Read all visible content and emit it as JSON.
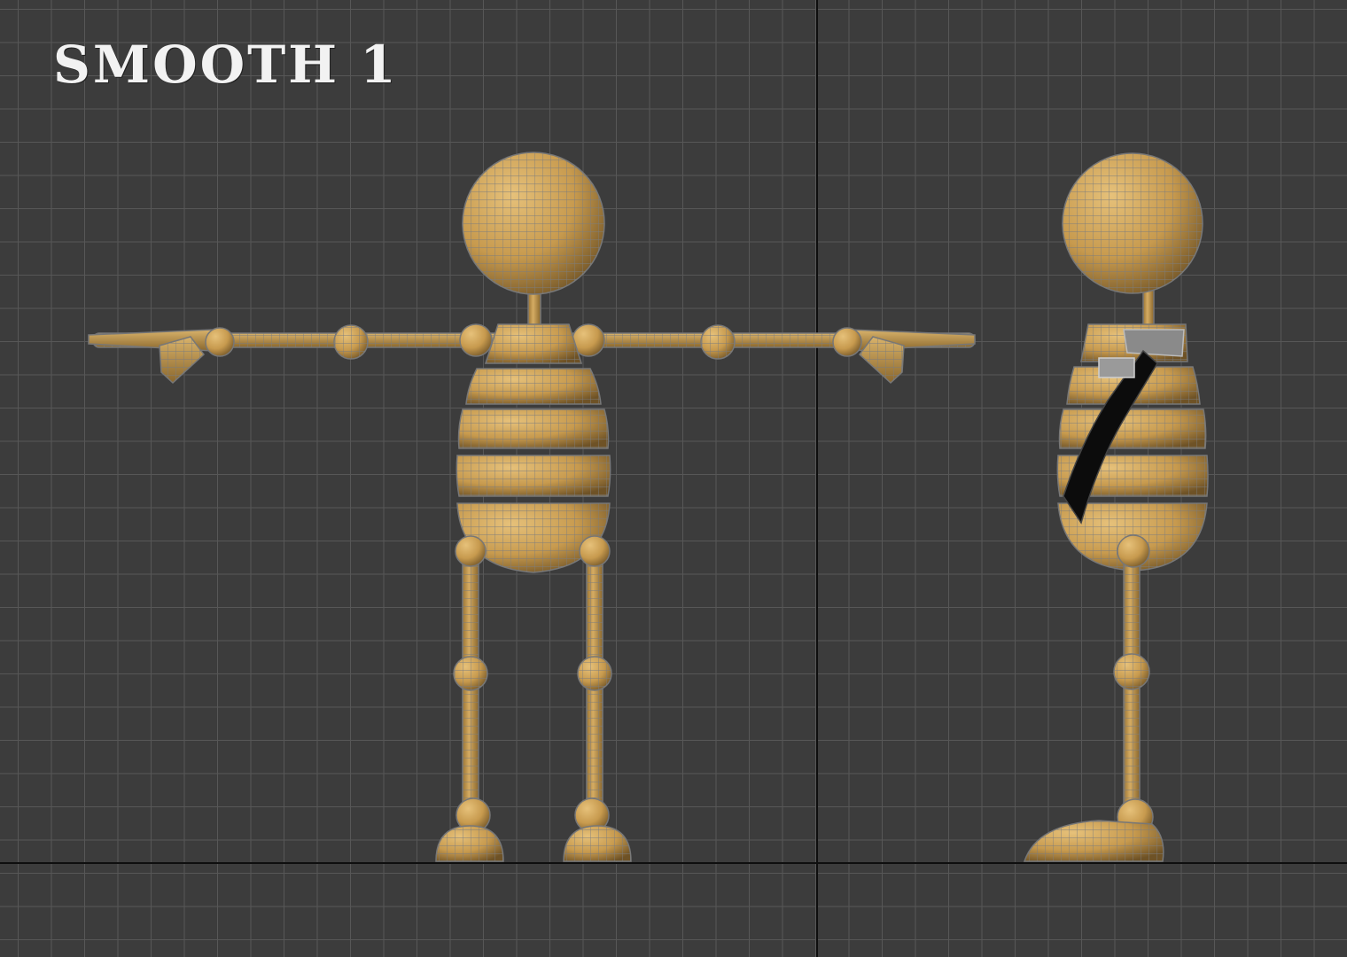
{
  "viewport": {
    "label": "SMOOTH 1",
    "background_color": "#3c3c3c",
    "grid_color": "#575757",
    "axis_color": "#0e0e0e",
    "model_color": "#c79a4e",
    "wire_color": "#7d7d7d"
  },
  "views": [
    "front-view",
    "side-view"
  ]
}
